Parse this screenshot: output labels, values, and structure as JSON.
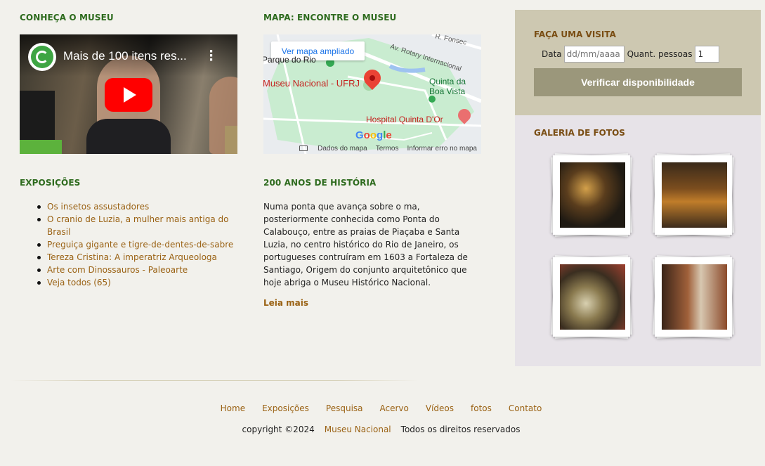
{
  "sections": {
    "museum_heading": "CONHEÇA O MUSEU",
    "map_heading": "MAPA: ENCONTRE O MUSEU",
    "exhibitions_heading": "EXPOSIÇÕES",
    "history_heading": "200 ANOS DE HISTÓRIA"
  },
  "video": {
    "title": "Mais de 100 itens res...",
    "icons": [
      "channel-logo-icon",
      "kebab-menu-icon",
      "play-icon"
    ]
  },
  "map": {
    "enlarge_button": "Ver mapa ampliado",
    "labels": {
      "museu": "Museu Nacional - UFRJ",
      "parque": "Parque do Rio",
      "quinta1": "Quinta da",
      "quinta2": "Boa Vista",
      "hospital": "Hospital Quinta D'Or",
      "avenida": "Av. Rotary Internacional",
      "rua": "R. Fonsec"
    },
    "google": "Google",
    "footer": {
      "data": "Dados do mapa",
      "terms": "Termos",
      "report": "Informar erro no mapa"
    }
  },
  "exhibitions": [
    "Os insetos assustadores",
    "O cranio de Luzia, a mulher mais antiga do Brasil",
    "Preguiça gigante e tigre-de-dentes-de-sabre",
    "Tereza Cristina: A imperatriz Arqueologa",
    "Arte com Dinossauros - Paleoarte",
    "Veja todos (65)"
  ],
  "history": {
    "text": "Numa ponta que avança sobre o ma, posteriormente conhecida como Ponta do Calabouço, entre as praias de Piaçaba e Santa Luzia, no centro histórico do Rio de Janeiro, os portugueses contruíram em 1603 a Fortaleza de Santiago, Origem do conjunto arquitetônico que hoje abriga o Museu Histórico Nacional.",
    "read_more": "Leia mais"
  },
  "visit": {
    "title": "FAÇA UMA VISITA",
    "date_label": "Data",
    "date_placeholder": "dd/mm/aaaa",
    "people_label": "Quant. pessoas",
    "people_value": "1",
    "button": "Verificar disponibilidade"
  },
  "gallery": {
    "title": "GALERIA DE FOTOS",
    "photos": [
      "photo-1",
      "photo-2",
      "photo-3",
      "photo-4"
    ]
  },
  "footer": {
    "nav": [
      "Home",
      "Exposições",
      "Pesquisa",
      "Acervo",
      "Vídeos",
      "fotos",
      "Contato"
    ],
    "copyright": "copyright ©2024",
    "museum_link": "Museu Nacional",
    "rights": "Todos os direitos reservados"
  },
  "colors": {
    "heading_green": "#2e6b1e",
    "link_brown": "#9a6214",
    "visit_panel": "#cdc8b1",
    "button": "#9b977b",
    "sidebar": "#e7e3e8",
    "background": "#f2f1ec"
  }
}
